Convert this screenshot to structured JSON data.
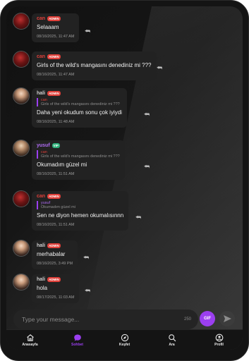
{
  "messages": [
    {
      "user": "can",
      "badge": "ADMIN",
      "text": "Selaaam",
      "time": "08/16/2025, 11:47 AM"
    },
    {
      "user": "can",
      "badge": "ADMIN",
      "text": "Girls of the wild's mangasını denediniz mi ???",
      "time": "08/16/2025, 11:47 AM"
    },
    {
      "user": "hali",
      "badge": "ADMIN",
      "reply_user": "can",
      "reply_text": "Girls of the wild's mangasını denediniz mi ???",
      "text": "Daha yeni okudum sonu çok iyiydi",
      "time": "08/16/2025, 11:48 AM"
    },
    {
      "user": "yusuf",
      "badge": "VIP",
      "reply_user": "can",
      "reply_text": "Girls of the wild's mangasını denediniz mi ???",
      "text": "Okumadım güzel mi",
      "time": "08/16/2025, 11:51 AM"
    },
    {
      "user": "can",
      "badge": "ADMIN",
      "reply_user": "yusuf",
      "reply_text": "Okumadım güzel mi",
      "text": "Sen ne diyon hemen okumalısınnn",
      "time": "08/16/2025, 11:51 AM"
    },
    {
      "user": "hali",
      "badge": "ADMIN",
      "text": "merhabalar",
      "time": "08/16/2025, 3:49 PM"
    },
    {
      "user": "hali",
      "badge": "ADMIN",
      "text": "hola",
      "time": "08/17/2025, 11:03 AM"
    }
  ],
  "composer": {
    "placeholder": "Type your message...",
    "counter": "250",
    "gif_label": "GIF"
  },
  "nav": [
    {
      "label": "Anasayfa",
      "icon": "home-icon",
      "active": false
    },
    {
      "label": "Sohbet",
      "icon": "chat-icon",
      "active": true
    },
    {
      "label": "Keşfet",
      "icon": "compass-icon",
      "active": false
    },
    {
      "label": "Ara",
      "icon": "search-icon",
      "active": false
    },
    {
      "label": "Profil",
      "icon": "profile-icon",
      "active": false
    }
  ],
  "colors": {
    "accent": "#9b3ff0",
    "admin_badge": "#e0403a",
    "vip_badge": "#2fb07a",
    "background": "#141414",
    "bubble": "#222222"
  }
}
